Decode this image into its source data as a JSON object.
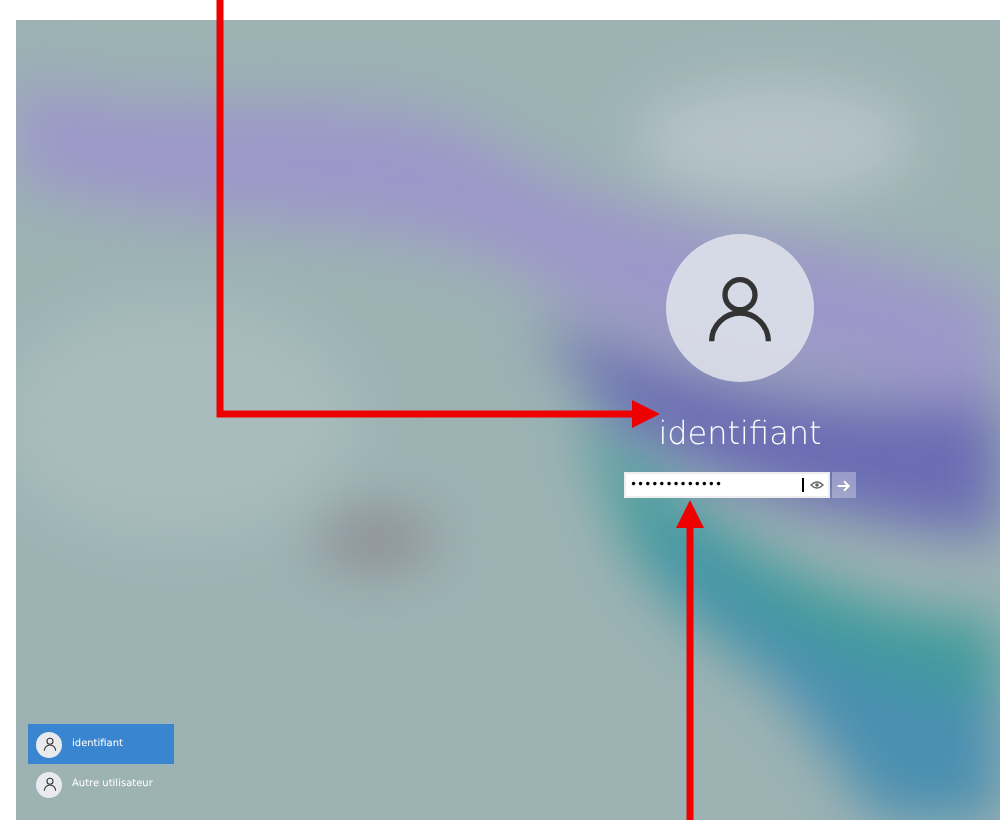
{
  "login": {
    "username": "identifiant",
    "password": {
      "value": "•••••••••••••"
    }
  },
  "users": [
    {
      "name": "identifiant",
      "selected": true
    },
    {
      "name": "Autre utilisateur",
      "selected": false
    }
  ]
}
